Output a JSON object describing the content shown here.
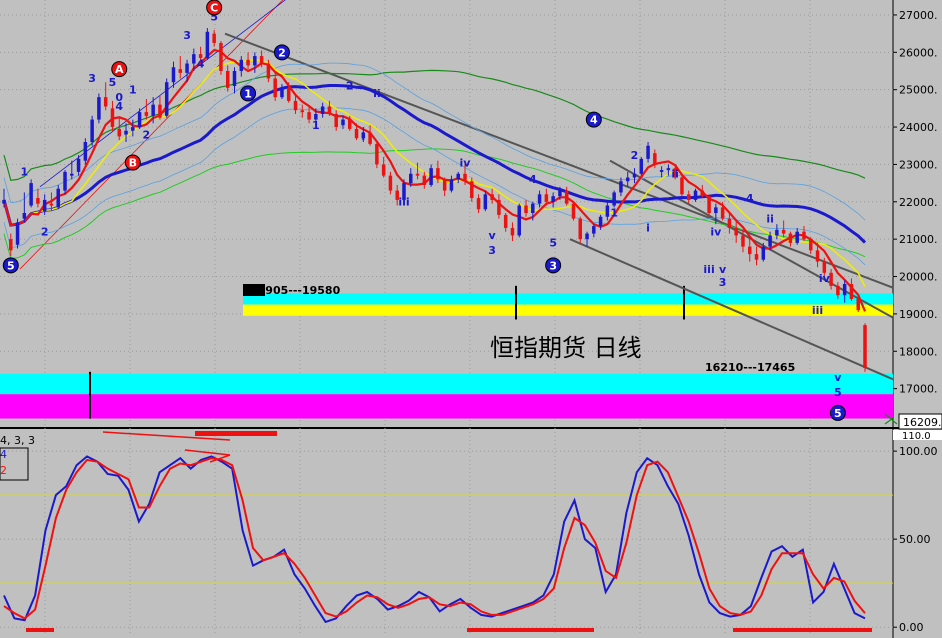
{
  "chart": {
    "title": "恒指期货 日线",
    "current_price_label": "16209.",
    "osc_legend_params": "4, 3, 3",
    "osc_legend_k": "4",
    "osc_legend_d": "2",
    "band_upper_label": "18905---19580",
    "band_lower_label": "16210---17465",
    "scale_cut_label": "110.0"
  },
  "colors": {
    "background": "#c0c0c0",
    "bull_candle": "#1a1acc",
    "bear_candle": "#ee1111",
    "neutral_candle": "#000000",
    "band_cyan": "#00ffff",
    "band_yellow": "#ffff00",
    "band_magenta": "#ff00ff"
  },
  "chart_data": [
    {
      "type": "candlestick",
      "y_axis_ticks": [
        "27000.",
        "26000.",
        "25000.",
        "24000.",
        "23000.",
        "22000.",
        "21000.",
        "20000.",
        "19000.",
        "18000.",
        "17000."
      ],
      "ylim": [
        16000,
        27400
      ],
      "candles": [
        [
          21950,
          22350,
          21850,
          22050
        ],
        [
          21000,
          21150,
          20550,
          20700
        ],
        [
          20850,
          21550,
          20750,
          21450
        ],
        [
          21550,
          22250,
          21450,
          21700
        ],
        [
          21900,
          22600,
          21850,
          22500
        ],
        [
          22100,
          22350,
          21850,
          21950
        ],
        [
          21750,
          22200,
          21650,
          22050
        ],
        [
          21950,
          22250,
          21750,
          21900
        ],
        [
          21850,
          22450,
          21800,
          22350
        ],
        [
          22300,
          22850,
          22200,
          22800
        ],
        [
          22700,
          23100,
          22600,
          22750
        ],
        [
          22800,
          23250,
          22700,
          23150
        ],
        [
          23100,
          23700,
          23000,
          23600
        ],
        [
          23600,
          24300,
          23500,
          24200
        ],
        [
          24200,
          24900,
          24100,
          24800
        ],
        [
          24800,
          25200,
          24450,
          24550
        ],
        [
          24500,
          24700,
          23900,
          24000
        ],
        [
          23950,
          24250,
          23650,
          23750
        ],
        [
          23800,
          24100,
          23600,
          23900
        ],
        [
          23900,
          24200,
          23750,
          24000
        ],
        [
          24000,
          24500,
          23950,
          24400
        ],
        [
          24400,
          24750,
          24200,
          24300
        ],
        [
          24300,
          24800,
          24100,
          24600
        ],
        [
          24600,
          24850,
          24200,
          24250
        ],
        [
          24300,
          25300,
          24250,
          25200
        ],
        [
          25200,
          25750,
          25050,
          25600
        ],
        [
          25550,
          25900,
          25300,
          25450
        ],
        [
          25450,
          25800,
          25200,
          25700
        ],
        [
          25700,
          26100,
          25500,
          25950
        ],
        [
          25950,
          26150,
          25700,
          25850
        ],
        [
          25850,
          26650,
          25800,
          26550
        ],
        [
          26500,
          26600,
          26150,
          26250
        ],
        [
          26250,
          26300,
          25400,
          25500
        ],
        [
          25500,
          25650,
          24950,
          25050
        ],
        [
          25100,
          25600,
          24900,
          25500
        ],
        [
          25500,
          25900,
          25350,
          25800
        ],
        [
          25800,
          26000,
          25550,
          25650
        ],
        [
          25650,
          26000,
          25450,
          25900
        ],
        [
          25900,
          26050,
          25600,
          25700
        ],
        [
          25700,
          25800,
          25200,
          25300
        ],
        [
          25300,
          25450,
          24700,
          24800
        ],
        [
          24800,
          25150,
          24750,
          25050
        ],
        [
          25050,
          25200,
          24650,
          24700
        ],
        [
          24700,
          24850,
          24350,
          24450
        ],
        [
          24450,
          24600,
          24250,
          24400
        ],
        [
          24400,
          24550,
          24100,
          24200
        ],
        [
          24200,
          24500,
          24100,
          24350
        ],
        [
          24350,
          24650,
          24250,
          24550
        ],
        [
          24550,
          24700,
          24300,
          24350
        ],
        [
          24350,
          24450,
          23900,
          24000
        ],
        [
          24050,
          24300,
          23950,
          24200
        ],
        [
          24200,
          24300,
          23900,
          23950
        ],
        [
          23950,
          24100,
          23650,
          23700
        ],
        [
          23700,
          24000,
          23600,
          23850
        ],
        [
          23850,
          24050,
          23500,
          23550
        ],
        [
          23550,
          23600,
          22900,
          23000
        ],
        [
          23000,
          23200,
          22650,
          22700
        ],
        [
          22700,
          22800,
          22200,
          22300
        ],
        [
          22300,
          22450,
          21900,
          22050
        ],
        [
          22050,
          22600,
          21950,
          22500
        ],
        [
          22500,
          22900,
          22400,
          22750
        ],
        [
          22750,
          23050,
          22600,
          22700
        ],
        [
          22700,
          22800,
          22350,
          22450
        ],
        [
          22450,
          23000,
          22400,
          22900
        ],
        [
          22900,
          23100,
          22500,
          22600
        ],
        [
          22600,
          22650,
          22150,
          22300
        ],
        [
          22300,
          22700,
          22250,
          22600
        ],
        [
          22600,
          22800,
          22500,
          22750
        ],
        [
          22750,
          23000,
          22450,
          22550
        ],
        [
          22550,
          22650,
          22000,
          22100
        ],
        [
          22100,
          22200,
          21700,
          21800
        ],
        [
          21800,
          22300,
          21750,
          22200
        ],
        [
          22200,
          22350,
          21950,
          22050
        ],
        [
          22050,
          22200,
          21550,
          21650
        ],
        [
          21650,
          21700,
          21200,
          21300
        ],
        [
          21300,
          21450,
          20950,
          21100
        ],
        [
          21100,
          21950,
          21050,
          21900
        ],
        [
          21900,
          22050,
          21600,
          21700
        ],
        [
          21700,
          22000,
          21500,
          21950
        ],
        [
          21950,
          22300,
          21850,
          22200
        ],
        [
          22200,
          22350,
          21900,
          22000
        ],
        [
          22000,
          22250,
          21850,
          22150
        ],
        [
          22150,
          22400,
          22050,
          22300
        ],
        [
          22300,
          22400,
          21900,
          21950
        ],
        [
          21950,
          22000,
          21500,
          21550
        ],
        [
          21550,
          21600,
          20900,
          21000
        ],
        [
          21000,
          21200,
          20800,
          21150
        ],
        [
          21150,
          21400,
          21050,
          21350
        ],
        [
          21350,
          21650,
          21250,
          21600
        ],
        [
          21600,
          22000,
          21500,
          21900
        ],
        [
          21900,
          22300,
          21850,
          22250
        ],
        [
          22250,
          22650,
          22150,
          22550
        ],
        [
          22550,
          22800,
          22400,
          22650
        ],
        [
          22650,
          22900,
          22500,
          22750
        ],
        [
          22750,
          23200,
          22700,
          23150
        ],
        [
          23150,
          23600,
          23050,
          23500
        ],
        [
          23300,
          23400,
          22900,
          23000
        ],
        [
          22800,
          22950,
          22650,
          22850
        ],
        [
          22850,
          23000,
          22700,
          22900
        ],
        [
          22900,
          22950,
          22600,
          22650
        ],
        [
          22650,
          22700,
          22150,
          22200
        ],
        [
          22200,
          22300,
          21950,
          22050
        ],
        [
          22050,
          22350,
          22000,
          22300
        ],
        [
          22300,
          22450,
          22100,
          22150
        ],
        [
          22150,
          22200,
          21600,
          21700
        ],
        [
          21700,
          21950,
          21400,
          21850
        ],
        [
          21850,
          22000,
          21500,
          21550
        ],
        [
          21550,
          21700,
          21150,
          21300
        ],
        [
          21300,
          21500,
          20900,
          21100
        ],
        [
          21100,
          21250,
          20650,
          20800
        ],
        [
          20800,
          21100,
          20400,
          20600
        ],
        [
          20600,
          20800,
          20300,
          20450
        ],
        [
          20450,
          20900,
          20400,
          20800
        ],
        [
          20800,
          21200,
          20700,
          21100
        ],
        [
          21100,
          21400,
          21000,
          21250
        ],
        [
          21250,
          21500,
          21050,
          21150
        ],
        [
          21150,
          21200,
          20800,
          20900
        ],
        [
          20900,
          21300,
          20850,
          21200
        ],
        [
          21200,
          21350,
          20950,
          21000
        ],
        [
          21000,
          21050,
          20600,
          20700
        ],
        [
          20700,
          20900,
          20250,
          20400
        ],
        [
          20400,
          20500,
          20000,
          20100
        ],
        [
          20100,
          20200,
          19650,
          19750
        ],
        [
          19750,
          19850,
          19400,
          19500
        ],
        [
          19500,
          19900,
          19300,
          19800
        ],
        [
          19800,
          19950,
          19350,
          19400
        ],
        [
          19400,
          19500,
          19050,
          19100
        ],
        [
          18700,
          18750,
          17450,
          17550
        ]
      ],
      "waves": [
        {
          "t": "5",
          "circle": "#1a1acc",
          "x": 1,
          "y": 20300
        },
        {
          "t": "1",
          "x": 3,
          "y": 22700
        },
        {
          "t": "2",
          "x": 6,
          "y": 21100
        },
        {
          "t": "3",
          "x": 13,
          "y": 25200
        },
        {
          "t": "5",
          "x": 16,
          "y": 25100
        },
        {
          "t": "0",
          "x": 17,
          "y": 24700
        },
        {
          "t": "4",
          "x": 17,
          "y": 24450
        },
        {
          "t": "1",
          "x": 19,
          "y": 24900
        },
        {
          "t": "2",
          "x": 21,
          "y": 23700
        },
        {
          "t": "A",
          "circle": "#ee1111",
          "x": 17,
          "y": 25550
        },
        {
          "t": "B",
          "circle": "#ee1111",
          "x": 19,
          "y": 23050
        },
        {
          "t": "3",
          "x": 27,
          "y": 26350
        },
        {
          "t": "4",
          "x": 29,
          "y": 25600
        },
        {
          "t": "5",
          "x": 31,
          "y": 26850
        },
        {
          "t": "C",
          "circle": "#ee1111",
          "x": 31,
          "y": 27200
        },
        {
          "t": "1",
          "circle": "#1a1acc",
          "x": 36,
          "y": 24900
        },
        {
          "t": "2",
          "circle": "#1a1acc",
          "x": 41,
          "y": 26000
        },
        {
          "t": "1",
          "x": 46,
          "y": 23950
        },
        {
          "t": "2",
          "x": 51,
          "y": 25000
        },
        {
          "t": "i",
          "x": 53,
          "y": 23650
        },
        {
          "t": "ii",
          "x": 55,
          "y": 24800
        },
        {
          "t": "iii",
          "x": 59,
          "y": 21900
        },
        {
          "t": "iv",
          "x": 68,
          "y": 22950
        },
        {
          "t": "4",
          "x": 78,
          "y": 22500
        },
        {
          "t": "v",
          "x": 72,
          "y": 21000
        },
        {
          "t": "3",
          "x": 72,
          "y": 20600
        },
        {
          "t": "5",
          "x": 81,
          "y": 20800
        },
        {
          "t": "3",
          "circle": "#1a1acc",
          "x": 81,
          "y": 20300
        },
        {
          "t": "4",
          "circle": "#1a1acc",
          "x": 87,
          "y": 24200
        },
        {
          "t": "1",
          "x": 90,
          "y": 21600
        },
        {
          "t": "2",
          "x": 93,
          "y": 23150
        },
        {
          "t": "i",
          "x": 95,
          "y": 21200
        },
        {
          "t": "ii",
          "x": 99,
          "y": 22650
        },
        {
          "t": "iii",
          "x": 104,
          "y": 20100
        },
        {
          "t": "iv",
          "x": 105,
          "y": 21100
        },
        {
          "t": "v",
          "x": 106,
          "y": 20100
        },
        {
          "t": "3",
          "x": 106,
          "y": 19750
        },
        {
          "t": "4",
          "x": 110,
          "y": 22000
        },
        {
          "t": "ii",
          "x": 113,
          "y": 21450
        },
        {
          "t": "i",
          "x": 112,
          "y": 20500
        },
        {
          "t": "iv",
          "x": 121,
          "y": 19850
        },
        {
          "t": "iii",
          "x": 120,
          "y": 19000
        },
        {
          "t": "v",
          "x": 123,
          "y": 17200
        },
        {
          "t": "5",
          "x": 123,
          "y": 16800
        },
        {
          "t": "5",
          "circle": "#1a1acc",
          "x": 123,
          "y": 16350
        }
      ]
    },
    {
      "type": "line",
      "name_params": "4, 3, 3",
      "y_axis_ticks": [
        "100.00",
        "50.00",
        "0.00"
      ],
      "ylim": [
        -5,
        112
      ],
      "reference_lines": [
        75,
        25
      ],
      "series": [
        {
          "name": "4",
          "color": "#1a1acc",
          "values": [
            18,
            5,
            4,
            18,
            55,
            75,
            80,
            92,
            97,
            94,
            87,
            86,
            78,
            60,
            70,
            88,
            92,
            96,
            90,
            95,
            97,
            94,
            90,
            55,
            35,
            38,
            40,
            44,
            30,
            22,
            12,
            3,
            5,
            12,
            18,
            20,
            16,
            10,
            12,
            15,
            20,
            17,
            9,
            13,
            16,
            11,
            7,
            6,
            8,
            10,
            12,
            14,
            18,
            30,
            60,
            72,
            50,
            45,
            20,
            30,
            65,
            88,
            96,
            92,
            80,
            70,
            52,
            30,
            14,
            8,
            6,
            7,
            12,
            28,
            43,
            46,
            40,
            44,
            14,
            20,
            36,
            22,
            8,
            5
          ]
        },
        {
          "name": "2",
          "color": "#ee1111",
          "values": [
            12,
            8,
            5,
            10,
            35,
            62,
            78,
            88,
            95,
            94,
            90,
            87,
            84,
            68,
            68,
            80,
            90,
            93,
            92,
            94,
            96,
            95,
            92,
            72,
            45,
            38,
            40,
            42,
            36,
            28,
            18,
            8,
            6,
            9,
            14,
            18,
            17,
            13,
            11,
            13,
            16,
            17,
            13,
            12,
            14,
            13,
            9,
            7,
            7,
            9,
            11,
            13,
            16,
            22,
            45,
            62,
            58,
            48,
            32,
            28,
            48,
            75,
            92,
            94,
            88,
            74,
            60,
            42,
            22,
            12,
            8,
            7,
            9,
            18,
            33,
            42,
            42,
            42,
            30,
            22,
            28,
            26,
            15,
            8
          ]
        }
      ]
    }
  ]
}
